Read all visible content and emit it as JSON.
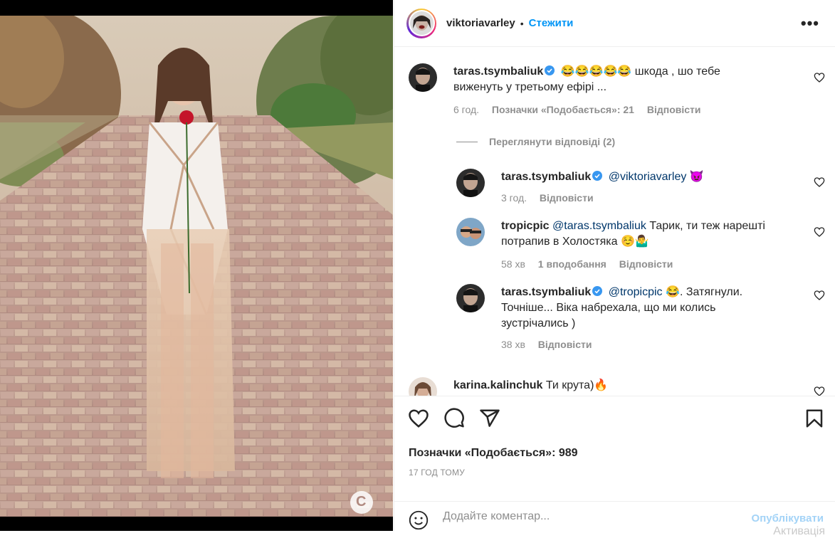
{
  "post": {
    "author": "viktoriavarley",
    "separator": "•",
    "follow_label": "Стежити",
    "more_label": "•••"
  },
  "photo": {
    "channel_logo": "C"
  },
  "comments": [
    {
      "user": "taras.tsymbaliuk",
      "verified": true,
      "text_line1": "шкода , шо тебе",
      "text_line2": "виженуть у третьому ефірі ...",
      "emojis": "😂😂😂😂😂",
      "time": "6 год.",
      "likes": "Позначки «Подобається»: 21",
      "reply": "Відповісти"
    }
  ],
  "view_replies": "Переглянути відповіді (2)",
  "replies": [
    {
      "user": "taras.tsymbaliuk",
      "mention": "@viktoriavarley",
      "emoji": "😈",
      "time": "3 год.",
      "reply": "Відповісти"
    },
    {
      "user": "tropicpic",
      "mention": "@taras.tsymbaliuk",
      "text_line1": "Тарик, ти теж нарешті",
      "text_line2": "потрапив в Холостяка ☺️🤷‍♂️",
      "time": "58 хв",
      "likes": "1 вподобання",
      "reply": "Відповісти"
    },
    {
      "user": "taras.tsymbaliuk",
      "mention": "@tropicpic",
      "emoji": "😂",
      "text_line1": ". Затягнули.",
      "text_line2": "Точніше... Віка набрехала, що ми колись",
      "text_line3": "зустрічались )",
      "time": "38 хв",
      "reply": "Відповісти"
    }
  ],
  "last_comment": {
    "user": "karina.kalinchuk",
    "text": "Ти крута)",
    "emoji": "🔥"
  },
  "actions": {
    "icons": [
      "heart-icon",
      "comment-icon",
      "share-icon",
      "bookmark-icon"
    ]
  },
  "likes_label": "Позначки «Подобається»:",
  "likes_count": "989",
  "posted_time": "17 ГОД ТОМУ",
  "add_comment": {
    "placeholder": "Додайте коментар...",
    "publish_label": "Опублікувати"
  },
  "watermark": "Активація",
  "colors": {
    "accent": "#0095f6",
    "verified": "#3897f0",
    "publish_disabled": "#a3d3f7"
  }
}
